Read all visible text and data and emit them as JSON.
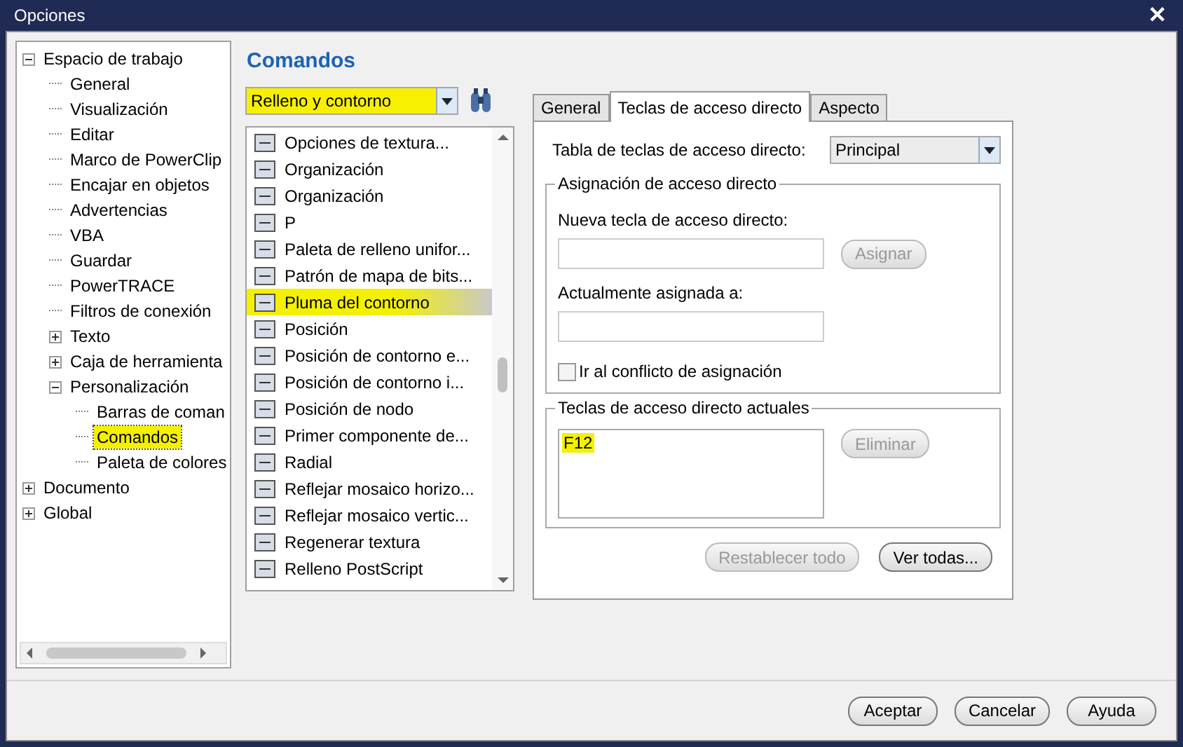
{
  "window": {
    "title": "Opciones",
    "close": "✕"
  },
  "tree": [
    {
      "label": "Espacio de trabajo",
      "expanded": true,
      "selected": false,
      "highlighted": false,
      "children": [
        {
          "label": "General",
          "selected": false,
          "highlighted": false
        },
        {
          "label": "Visualización",
          "selected": false,
          "highlighted": false
        },
        {
          "label": "Editar",
          "selected": false,
          "highlighted": false
        },
        {
          "label": "Marco de PowerClip",
          "selected": false,
          "highlighted": false
        },
        {
          "label": "Encajar en objetos",
          "selected": false,
          "highlighted": false
        },
        {
          "label": "Advertencias",
          "selected": false,
          "highlighted": false
        },
        {
          "label": "VBA",
          "selected": false,
          "highlighted": false
        },
        {
          "label": "Guardar",
          "selected": false,
          "highlighted": false
        },
        {
          "label": "PowerTRACE",
          "selected": false,
          "highlighted": false
        },
        {
          "label": "Filtros de conexión",
          "selected": false,
          "highlighted": false
        },
        {
          "label": "Texto",
          "expanded": false,
          "selected": false,
          "highlighted": false
        },
        {
          "label": "Caja de herramienta",
          "expanded": false,
          "selected": false,
          "highlighted": false
        },
        {
          "label": "Personalización",
          "expanded": true,
          "selected": false,
          "highlighted": false,
          "children": [
            {
              "label": "Barras de coman",
              "selected": false,
              "highlighted": false
            },
            {
              "label": "Comandos",
              "selected": true,
              "highlighted": true
            },
            {
              "label": "Paleta de colores",
              "selected": false,
              "highlighted": false
            }
          ]
        }
      ]
    },
    {
      "label": "Documento",
      "expanded": false,
      "selected": false,
      "highlighted": false
    },
    {
      "label": "Global",
      "expanded": false,
      "selected": false,
      "highlighted": false
    }
  ],
  "heading": "Comandos",
  "category": {
    "value": "Relleno y contorno",
    "highlighted": true
  },
  "commands": [
    {
      "label": "Opciones de textura...",
      "selected": false
    },
    {
      "label": "Organización",
      "selected": false
    },
    {
      "label": "Organización",
      "selected": false
    },
    {
      "label": "P",
      "selected": false
    },
    {
      "label": "Paleta de relleno unifor...",
      "selected": false
    },
    {
      "label": "Patrón de mapa de bits...",
      "selected": false
    },
    {
      "label": "Pluma del contorno",
      "selected": true
    },
    {
      "label": "Posición",
      "selected": false
    },
    {
      "label": "Posición de contorno e...",
      "selected": false
    },
    {
      "label": "Posición de contorno i...",
      "selected": false
    },
    {
      "label": "Posición de nodo",
      "selected": false
    },
    {
      "label": "Primer componente de...",
      "selected": false
    },
    {
      "label": "Radial",
      "selected": false
    },
    {
      "label": "Reflejar mosaico horizo...",
      "selected": false
    },
    {
      "label": "Reflejar mosaico vertic...",
      "selected": false
    },
    {
      "label": "Regenerar textura",
      "selected": false
    },
    {
      "label": "Relleno PostScript",
      "selected": false
    }
  ],
  "tabs": [
    {
      "label": "General",
      "selected": false
    },
    {
      "label": "Teclas de acceso directo",
      "selected": true
    },
    {
      "label": "Aspecto",
      "selected": false
    }
  ],
  "shortcut_table": {
    "label": "Tabla de teclas de acceso directo:",
    "value": "Principal"
  },
  "assignment": {
    "title": "Asignación de acceso directo",
    "new_key_label": "Nueva tecla de acceso directo:",
    "assign_button": "Asignar",
    "current_label": "Actualmente asignada a:",
    "conflict": {
      "label": "Ir al conflicto de asignación",
      "checked": false
    }
  },
  "current_keys": {
    "title": "Teclas de acceso directo actuales",
    "keys": [
      {
        "label": "F12",
        "highlighted": true
      }
    ],
    "delete_button": "Eliminar"
  },
  "reset_button": "Restablecer todo",
  "view_all_button": "Ver todas...",
  "buttons": [
    "Aceptar",
    "Cancelar",
    "Ayuda"
  ]
}
